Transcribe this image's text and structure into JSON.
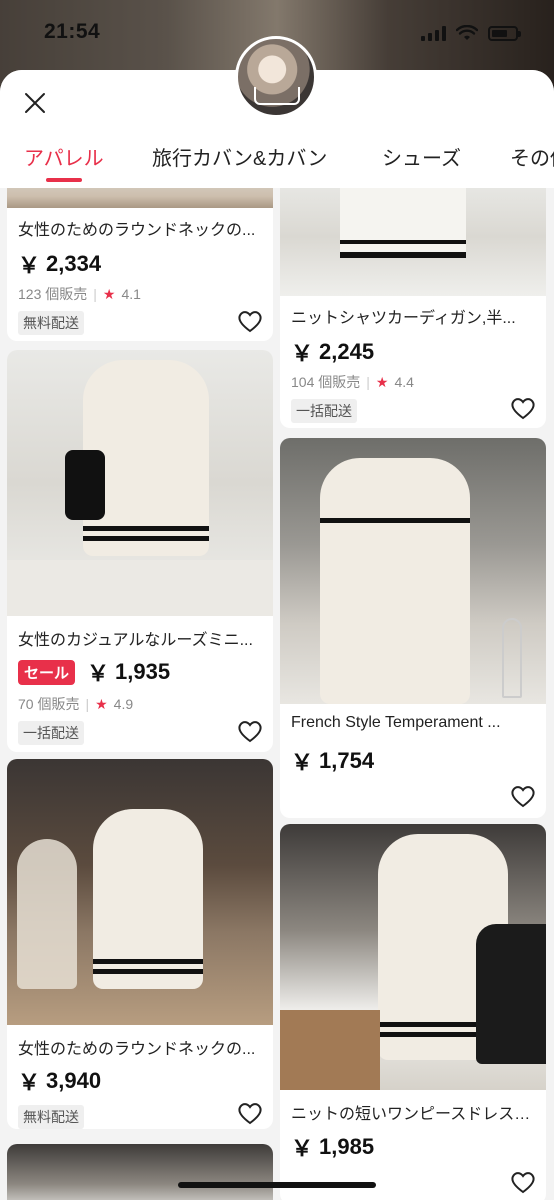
{
  "status": {
    "time": "21:54"
  },
  "tabs": [
    {
      "label": "アパレル"
    },
    {
      "label": "旅行カバン&カバン"
    },
    {
      "label": "シューズ"
    },
    {
      "label": "その他"
    }
  ],
  "products": {
    "left": [
      {
        "title": "女性のためのラウンドネックの...",
        "price": "2,334",
        "sold": "123 個販売",
        "rating": "4.1",
        "shipping": "無料配送",
        "sale": ""
      },
      {
        "title": "女性のカジュアルなルーズミニ...",
        "price": "1,935",
        "sold": "70 個販売",
        "rating": "4.9",
        "shipping": "一括配送",
        "sale": "セール"
      },
      {
        "title": "女性のためのラウンドネックの...",
        "price": "3,940",
        "sold": "",
        "rating": "",
        "shipping": "無料配送",
        "sale": ""
      }
    ],
    "right": [
      {
        "title": "ニットシャツカーディガン,半...",
        "price": "2,245",
        "sold": "104 個販売",
        "rating": "4.4",
        "shipping": "一括配送",
        "sale": ""
      },
      {
        "title": "French Style Temperament ...",
        "price": "1,754",
        "sold": "",
        "rating": "",
        "shipping": "",
        "sale": ""
      },
      {
        "title": "ニットの短いワンピースドレス,...",
        "price": "1,985",
        "sold": "",
        "rating": "",
        "shipping": "",
        "sale": ""
      }
    ]
  },
  "currency_symbol": "￥",
  "colors": {
    "accent": "#e8304a"
  }
}
